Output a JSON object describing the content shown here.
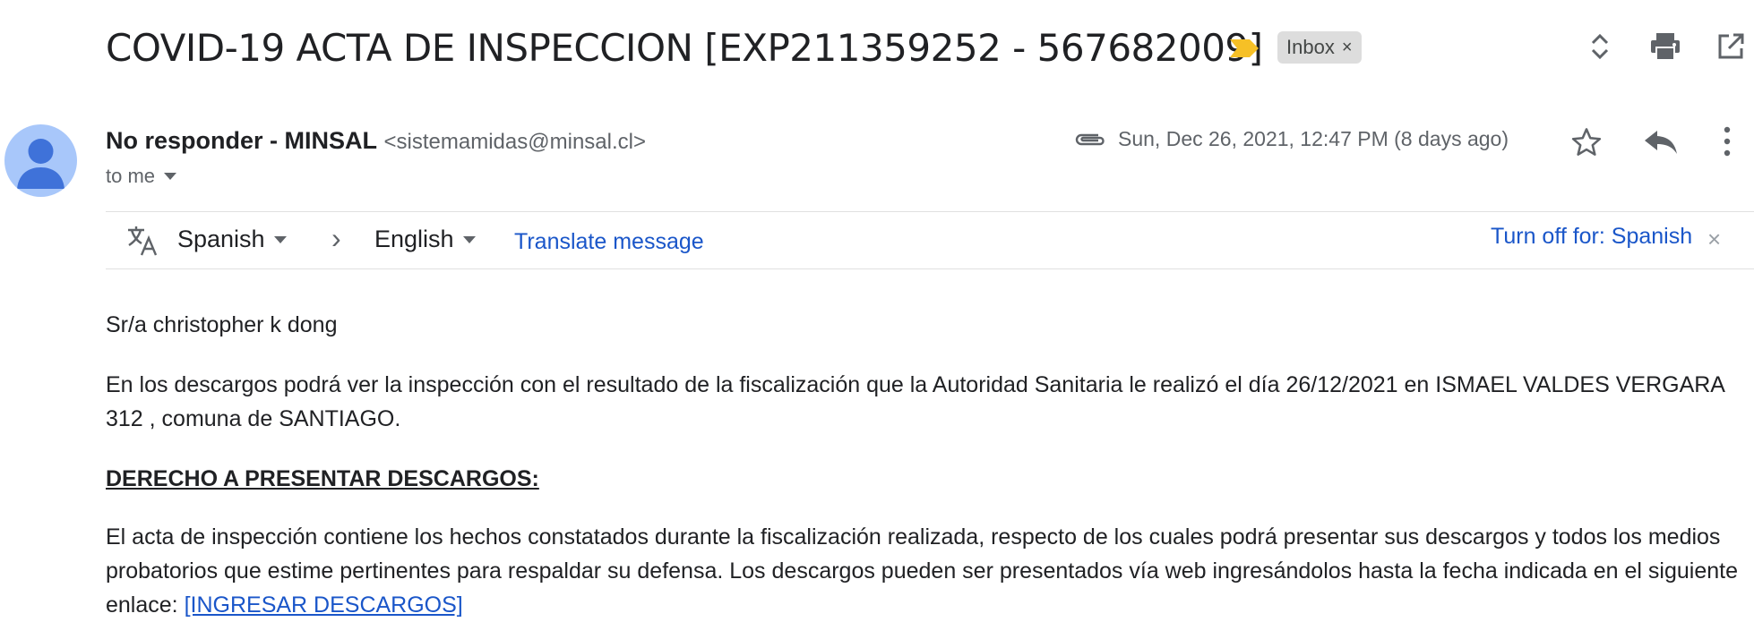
{
  "header": {
    "subject": "COVID-19 ACTA DE INSPECCION [EXP211359252 - 567682009]",
    "label_chip": "Inbox",
    "label_chip_close": "×",
    "icons": [
      "important-marker-icon",
      "expand-collapse-icon",
      "print-icon",
      "open-in-new-window-icon"
    ]
  },
  "message": {
    "sender_name": "No responder - MINSAL",
    "sender_email": "<sistemamidas@minsal.cl>",
    "recipient": "to me",
    "date": "Sun, Dec 26, 2021, 12:47 PM (8 days ago)",
    "icons": [
      "attachment-icon",
      "star-icon",
      "reply-icon",
      "more-options-icon"
    ]
  },
  "translate": {
    "from_language": "Spanish",
    "arrow": "›",
    "to_language": "English",
    "translate_link": "Translate message",
    "turn_off_link": "Turn off for: Spanish",
    "close": "×"
  },
  "body": {
    "greeting": "Sr/a christopher k dong",
    "paragraph1": "En los descargos podrá ver la inspección con el resultado de la fiscalización que la Autoridad Sanitaria le realizó el día 26/12/2021 en ISMAEL VALDES VERGARA 312 , comuna de SANTIAGO.",
    "heading": "DERECHO A PRESENTAR DESCARGOS:",
    "paragraph2": "El acta de inspección contiene los hechos constatados durante la fiscalización realizada, respecto de los cuales podrá presentar sus descargos y todos los medios probatorios que estime pertinentes para respaldar su defensa. Los descargos pueden ser presentados vía web ingresándolos hasta la fecha indicada en el siguiente enlace:",
    "link_text": "[INGRESAR DESCARGOS]"
  }
}
